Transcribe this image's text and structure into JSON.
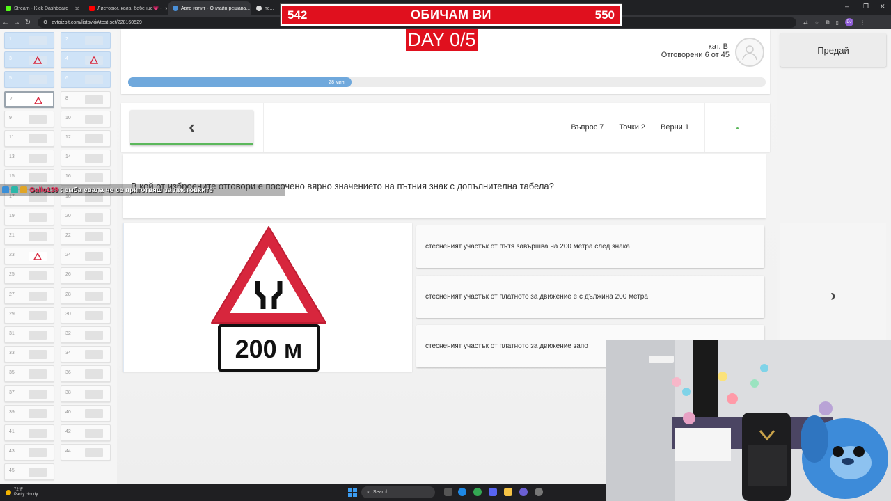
{
  "browser": {
    "tabs": [
      {
        "label": "Stream - Kick Dashboard",
        "color": "#53fc18"
      },
      {
        "label": "Листовки, кола, бебенце💗 -",
        "color": "#ff0000"
      },
      {
        "label": "Авто изпит - Онлайн решава...",
        "color": "#4a90d9",
        "active": true
      },
      {
        "label": "пе...",
        "color": "#888888"
      }
    ],
    "url": "avtoizpit.com/listovki#/test-set/228160529",
    "profile_initials": "DJ"
  },
  "overlay": {
    "score_left": "542",
    "score_title": "ОБИЧАМ ВИ",
    "score_right": "550",
    "day_counter": "DAY 0/5",
    "chat_user": "Gallo139",
    "chat_message": ": емба евала че се приготвяш за листовките"
  },
  "sidebar": {
    "questions": [
      "1",
      "2",
      "3",
      "4",
      "5",
      "6",
      "7",
      "8",
      "9",
      "10",
      "11",
      "12",
      "13",
      "14",
      "15",
      "16",
      "17",
      "18",
      "19",
      "20",
      "21",
      "22",
      "23",
      "24",
      "25",
      "26",
      "27",
      "28",
      "29",
      "30",
      "31",
      "32",
      "33",
      "34",
      "35",
      "36",
      "37",
      "38",
      "39",
      "40",
      "41",
      "42",
      "43",
      "44",
      "45"
    ]
  },
  "header": {
    "category": "кат. B",
    "answered_label": "Отговорени 6 от  45",
    "timer": "28 мин",
    "progress_fraction": 0.35
  },
  "nav": {
    "prev_icon": "chevron-left-icon",
    "question_label": "Въпрос 7",
    "points_label": "Точки 2",
    "correct_label": "Верни 1"
  },
  "question": {
    "text": "В кой от изброените отговори е посочено вярно значението на пътния знак с допълнителна табела?",
    "sign_plate": "200 м"
  },
  "answers": [
    "стесненият участък от пътя завършва на 200 метра след знака",
    "стесненият участък от платното за движение е с дължина 200 метра",
    "стесненият участък от платното за движение запо"
  ],
  "actions": {
    "submit_label": "Предай",
    "next_icon": "chevron-right-icon"
  },
  "taskbar": {
    "temperature": "72°F",
    "weather": "Partly cloudy",
    "search_label": "Search"
  },
  "colors": {
    "accent_red": "#e0101e",
    "progress_blue": "#6fa8dc",
    "nav_green": "#5cb85c"
  }
}
